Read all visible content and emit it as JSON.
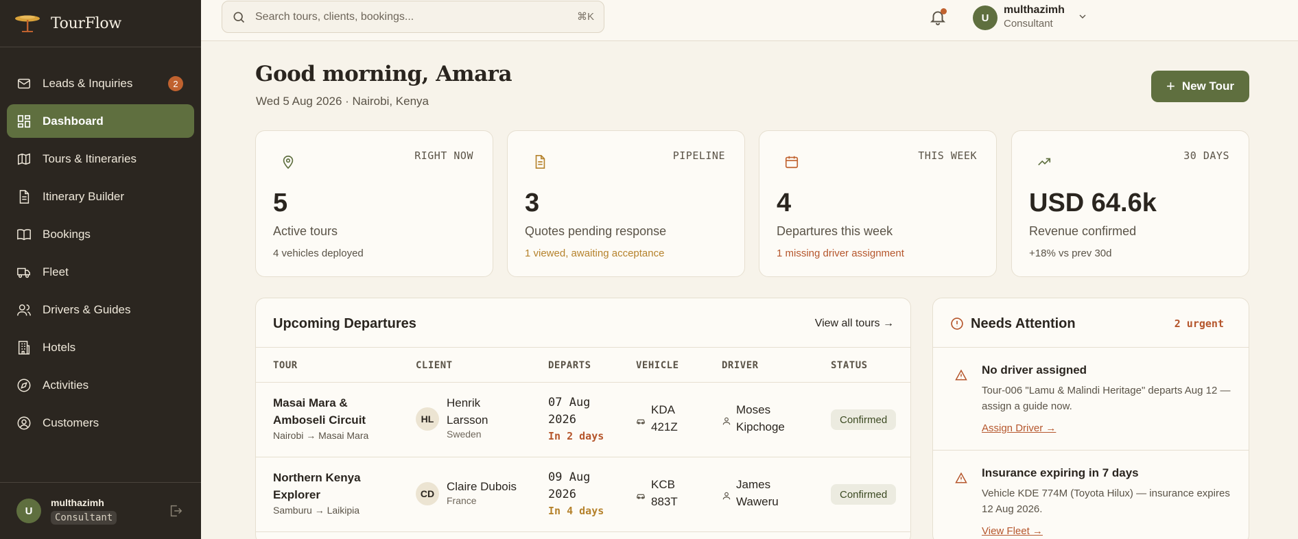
{
  "app": {
    "name": "TourFlow"
  },
  "sidebar": {
    "items": [
      {
        "label": "Leads & Inquiries",
        "icon": "mail-icon",
        "badge": "2"
      },
      {
        "label": "Dashboard",
        "icon": "dashboard-icon",
        "active": true
      },
      {
        "label": "Tours & Itineraries",
        "icon": "map-icon"
      },
      {
        "label": "Itinerary Builder",
        "icon": "document-icon"
      },
      {
        "label": "Bookings",
        "icon": "book-icon"
      },
      {
        "label": "Fleet",
        "icon": "truck-icon"
      },
      {
        "label": "Drivers & Guides",
        "icon": "users-icon"
      },
      {
        "label": "Hotels",
        "icon": "building-icon"
      },
      {
        "label": "Activities",
        "icon": "compass-icon"
      },
      {
        "label": "Customers",
        "icon": "user-circle-icon"
      }
    ],
    "user": {
      "initial": "U",
      "name": "multhazimh",
      "role": "Consultant"
    }
  },
  "topbar": {
    "search_placeholder": "Search tours, clients, bookings...",
    "shortcut": "⌘K",
    "user": {
      "initial": "U",
      "name": "multhazimh",
      "role": "Consultant"
    }
  },
  "header": {
    "greeting": "Good morning, Amara",
    "date_line": "Wed 5 Aug 2026 · Nairobi, Kenya",
    "new_tour_label": "New Tour"
  },
  "stats": [
    {
      "eyebrow": "RIGHT NOW",
      "value": "5",
      "label": "Active tours",
      "sub": "4 vehicles deployed",
      "icon": "map-pin-icon"
    },
    {
      "eyebrow": "PIPELINE",
      "value": "3",
      "label": "Quotes pending response",
      "sub": "1 viewed, awaiting acceptance",
      "icon": "file-text-icon"
    },
    {
      "eyebrow": "THIS WEEK",
      "value": "4",
      "label": "Departures this week",
      "sub": "1 missing driver assignment",
      "icon": "calendar-icon"
    },
    {
      "eyebrow": "30 DAYS",
      "value": "USD 64.6k",
      "label": "Revenue confirmed",
      "sub": "+18% vs prev 30d",
      "icon": "trending-up-icon"
    }
  ],
  "departures": {
    "title": "Upcoming Departures",
    "view_all": "View all tours →",
    "columns": [
      "TOUR",
      "CLIENT",
      "DEPARTS",
      "VEHICLE",
      "DRIVER",
      "STATUS"
    ],
    "rows": [
      {
        "tour_line1": "Masai Mara &",
        "tour_line2": "Amboseli Circuit",
        "route": "Nairobi → Masai Mara",
        "client_initials": "HL",
        "client_line1": "Henrik",
        "client_line2": "Larsson",
        "country": "Sweden",
        "date_line1": "07 Aug",
        "date_line2": "2026",
        "in_days": "In 2 days",
        "vehicle_line1": "KDA",
        "vehicle_line2": "421Z",
        "driver_line1": "Moses",
        "driver_line2": "Kipchoge",
        "status": "Confirmed"
      },
      {
        "tour_line1": "Northern Kenya",
        "tour_line2": "Explorer",
        "route": "Samburu → Laikipia",
        "client_initials": "CD",
        "client_line1": "Claire Dubois",
        "client_line2": "",
        "country": "France",
        "date_line1": "09 Aug",
        "date_line2": "2026",
        "in_days": "In 4 days",
        "vehicle_line1": "KCB",
        "vehicle_line2": "883T",
        "driver_line1": "James",
        "driver_line2": "Waweru",
        "status": "Confirmed"
      }
    ]
  },
  "attention": {
    "title": "Needs Attention",
    "urgent": "2 urgent",
    "items": [
      {
        "title": "No driver assigned",
        "desc_line1": "Tour-006 \"Lamu & Malindi Heritage\" departs Aug 12 —",
        "desc_line2": "assign a guide now.",
        "link": "Assign Driver →"
      },
      {
        "title": "Insurance expiring in 7 days",
        "desc_line1": "Vehicle KDE 774M (Toyota Hilux) — insurance expires",
        "desc_line2": "12 Aug 2026.",
        "link": "View Fleet →"
      }
    ]
  },
  "colors": {
    "sidebar_bg": "#2b2620",
    "accent_green": "#5f6f3f",
    "accent_rust": "#c0622f",
    "accent_amber": "#b5822c",
    "page_bg": "#f7f3ea"
  }
}
